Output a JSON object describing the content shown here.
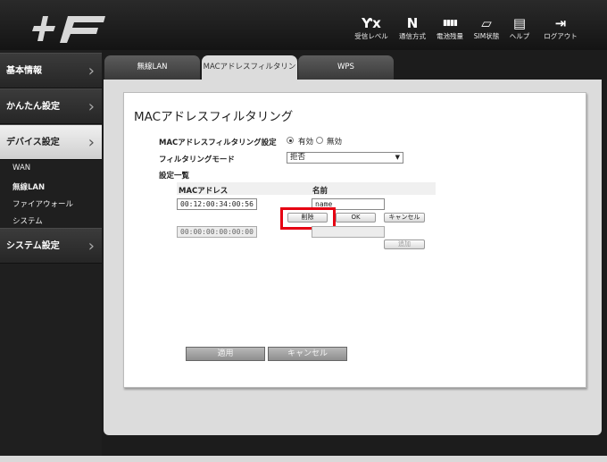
{
  "header": {
    "logo_alt": "+F",
    "icons": [
      {
        "name": "signal-icon",
        "glyph": "Ƴx",
        "label": "受信レベル"
      },
      {
        "name": "network-mode-icon",
        "glyph": "N",
        "label": "通信方式"
      },
      {
        "name": "battery-icon",
        "glyph": "▮▮▮▮",
        "label": "電池残量"
      },
      {
        "name": "sim-icon",
        "glyph": "▱",
        "label": "SIM状態"
      },
      {
        "name": "help-icon",
        "glyph": "▤",
        "label": "ヘルプ"
      },
      {
        "name": "logout-icon",
        "glyph": "⇥",
        "label": "ログアウト"
      }
    ]
  },
  "sidebar": {
    "main": [
      "基本情報",
      "かんたん設定",
      "デバイス設定",
      "システム設定"
    ],
    "sub": [
      "WAN",
      "無線LAN",
      "ファイアウォール",
      "システム"
    ]
  },
  "tabs": [
    "無線LAN",
    "MACアドレスフィルタリング",
    "WPS"
  ],
  "content": {
    "title": "MACアドレスフィルタリング",
    "filter_setting_label": "MACアドレスフィルタリング設定",
    "enable_label": "有効",
    "disable_label": "無効",
    "mode_label": "フィルタリングモード",
    "mode_value": "拒否",
    "list_label": "設定一覧",
    "col_mac": "MACアドレス",
    "col_name": "名前",
    "row_mac": "00:12:00:34:00:56",
    "row_name": "name",
    "new_mac": "00:00:00:00:00:00",
    "new_name": "",
    "delete_label": "削除",
    "ok_label": "OK",
    "cancel_small_label": "キャンセル",
    "add_label": "追加",
    "apply_label": "適用",
    "cancel_label": "キャンセル"
  },
  "colors": {
    "highlight": "#e60012"
  }
}
